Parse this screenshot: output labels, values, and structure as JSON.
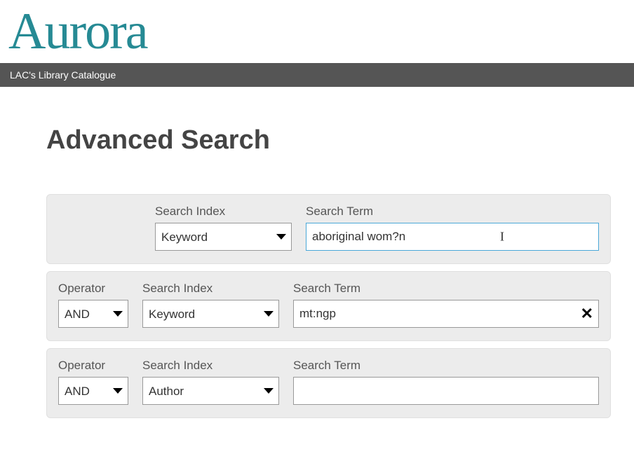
{
  "logo": {
    "text": "Aurora"
  },
  "navbar": {
    "label": "LAC's Library Catalogue"
  },
  "page": {
    "title": "Advanced Search"
  },
  "labels": {
    "operator": "Operator",
    "search_index": "Search Index",
    "search_term": "Search Term"
  },
  "rows": [
    {
      "has_operator": false,
      "operator": "",
      "index": "Keyword",
      "term": "aboriginal wom?n",
      "focused": true,
      "has_clear": false
    },
    {
      "has_operator": true,
      "operator": "AND",
      "index": "Keyword",
      "term": "mt:ngp",
      "focused": false,
      "has_clear": true
    },
    {
      "has_operator": true,
      "operator": "AND",
      "index": "Author",
      "term": "",
      "focused": false,
      "has_clear": false
    }
  ],
  "icons": {
    "clear": "✕"
  }
}
